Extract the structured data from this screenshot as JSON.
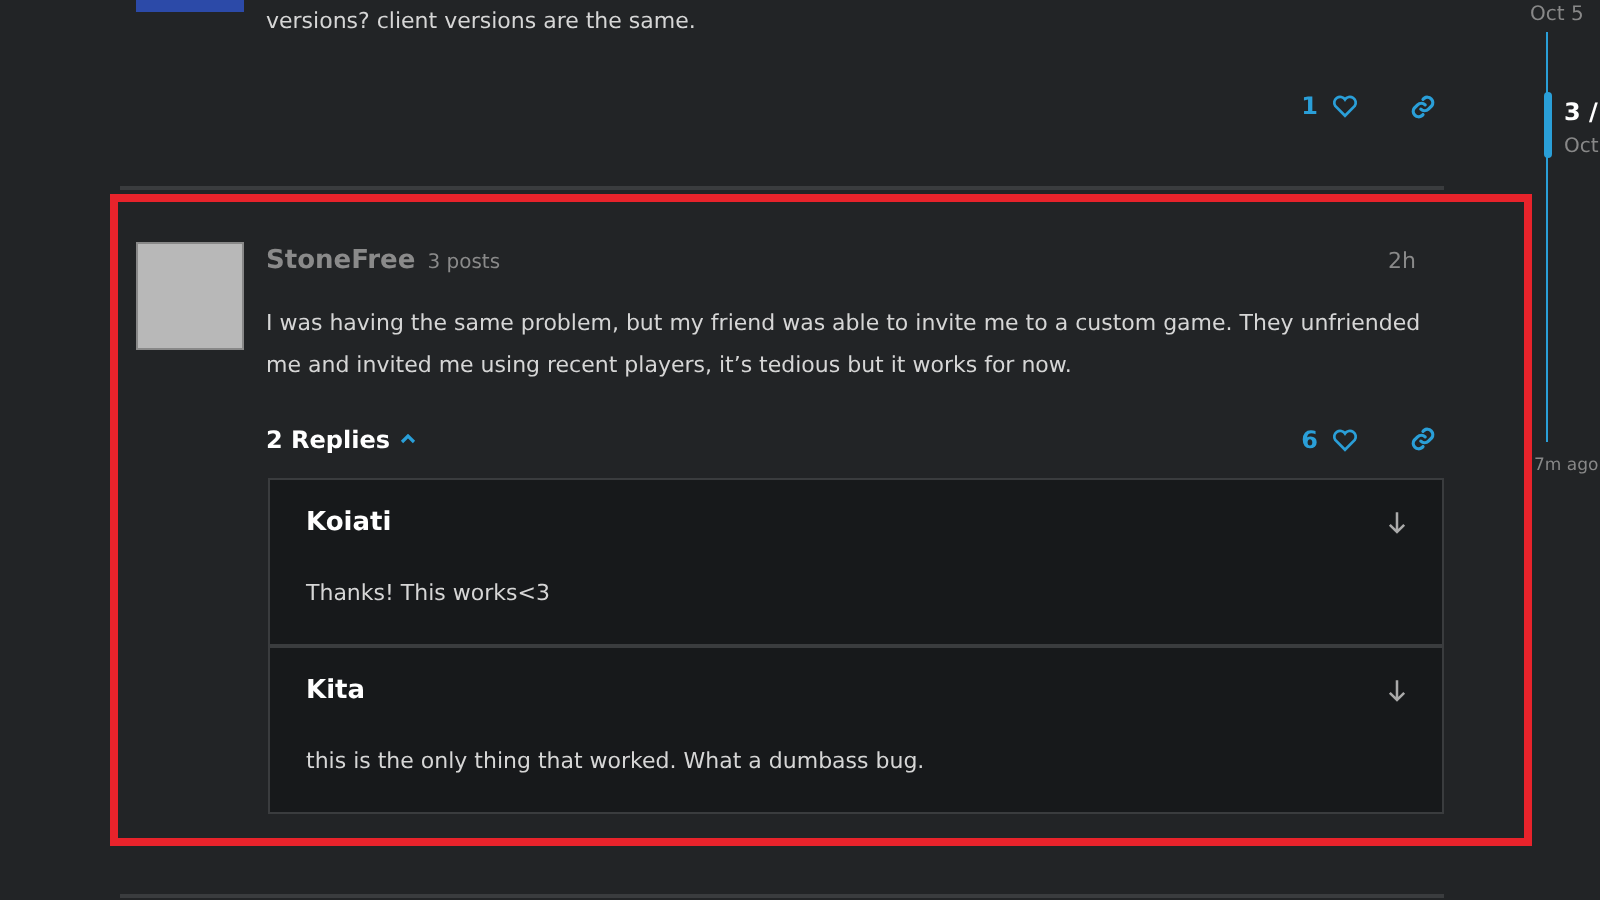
{
  "previous_post": {
    "body": "versions? client versions are the same.",
    "likes": "1"
  },
  "post": {
    "author": "StoneFree",
    "post_count": "3 posts",
    "time": "2h",
    "body": "I was having the same problem, but my friend was able to invite me to a custom game. They unfriended me and invited me using recent players, it’s tedious but it works for now.",
    "likes": "6",
    "replies_toggle": "2 Replies",
    "replies_expanded": true,
    "replies": [
      {
        "author": "Koiati",
        "body": "Thanks! This works<3"
      },
      {
        "author": "Kita",
        "body": "this is the only thing that worked. What a dumbass bug."
      }
    ]
  },
  "timeline": {
    "start_date": "Oct 5",
    "position": "3 /",
    "position_date": "Oct",
    "end_date": "7m ago"
  }
}
